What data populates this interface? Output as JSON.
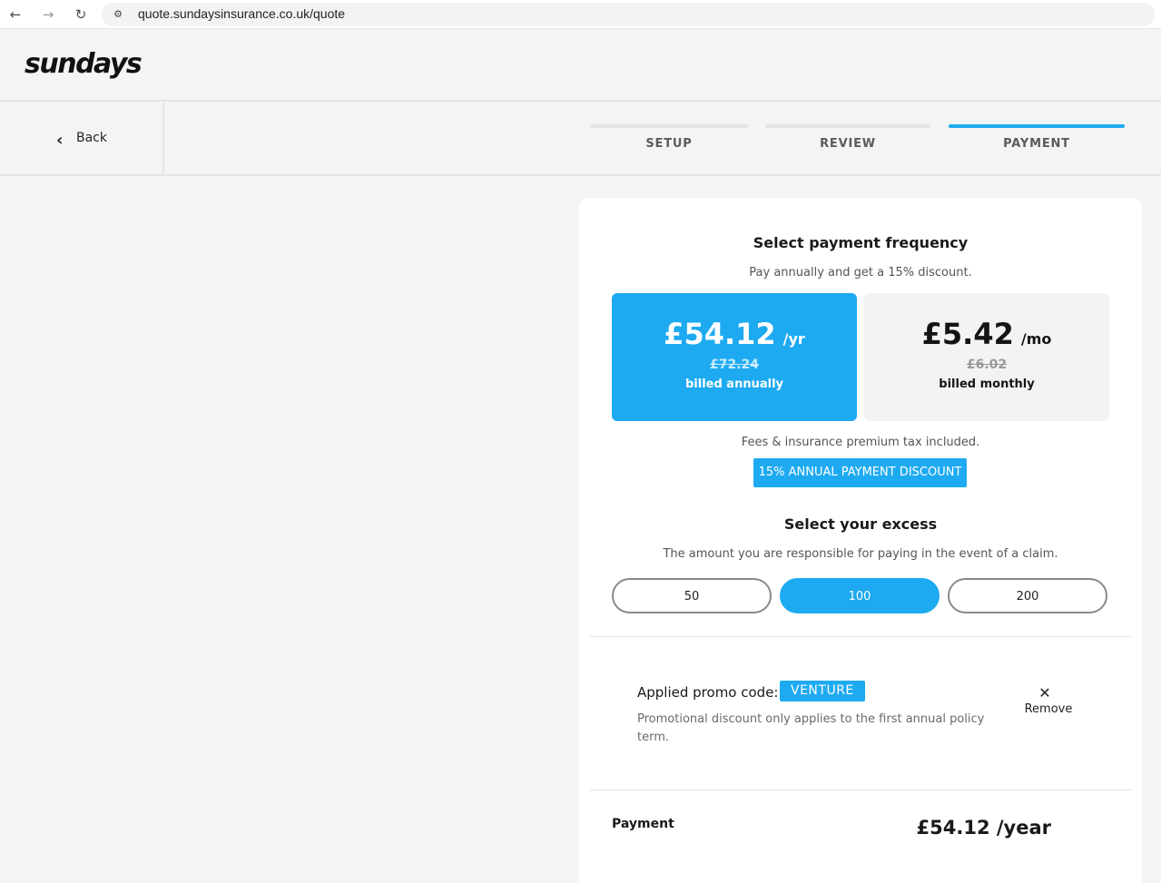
{
  "browser": {
    "url": "quote.sundaysinsurance.co.uk/quote",
    "back_icon": "←",
    "forward_icon": "→",
    "reload_icon": "↻",
    "site_icon": "⚙"
  },
  "header": {
    "logo": "sundays"
  },
  "steps": {
    "back_label": "Back",
    "back_icon": "‹",
    "items": [
      {
        "label": "SETUP",
        "active": false
      },
      {
        "label": "REVIEW",
        "active": false
      },
      {
        "label": "PAYMENT",
        "active": true
      }
    ]
  },
  "frequency": {
    "title": "Select payment frequency",
    "subtitle": "Pay annually and get a 15% discount.",
    "annual": {
      "amount": "£54.12",
      "per": "/yr",
      "old": "£72.24",
      "billed": "billed annually",
      "selected": true
    },
    "monthly": {
      "amount": "£5.42",
      "per": "/mo",
      "old": "£6.02",
      "billed": "billed monthly",
      "selected": false
    },
    "fees_note": "Fees & insurance premium tax included.",
    "discount_badge": "15% ANNUAL PAYMENT DISCOUNT"
  },
  "excess": {
    "title": "Select your excess",
    "subtitle": "The amount you are responsible for paying in the event of a claim.",
    "options": [
      "50",
      "100",
      "200"
    ],
    "selected": "100"
  },
  "promo": {
    "label": "Applied promo code:",
    "code": "VENTURE",
    "note": "Promotional discount only applies to the first annual policy term.",
    "remove_icon": "✕",
    "remove_label": "Remove"
  },
  "payment": {
    "label": "Payment",
    "total": "£54.12 /year"
  },
  "colors": {
    "accent": "#1eaaf1",
    "background": "#f4f4f4",
    "card": "#ffffff"
  }
}
